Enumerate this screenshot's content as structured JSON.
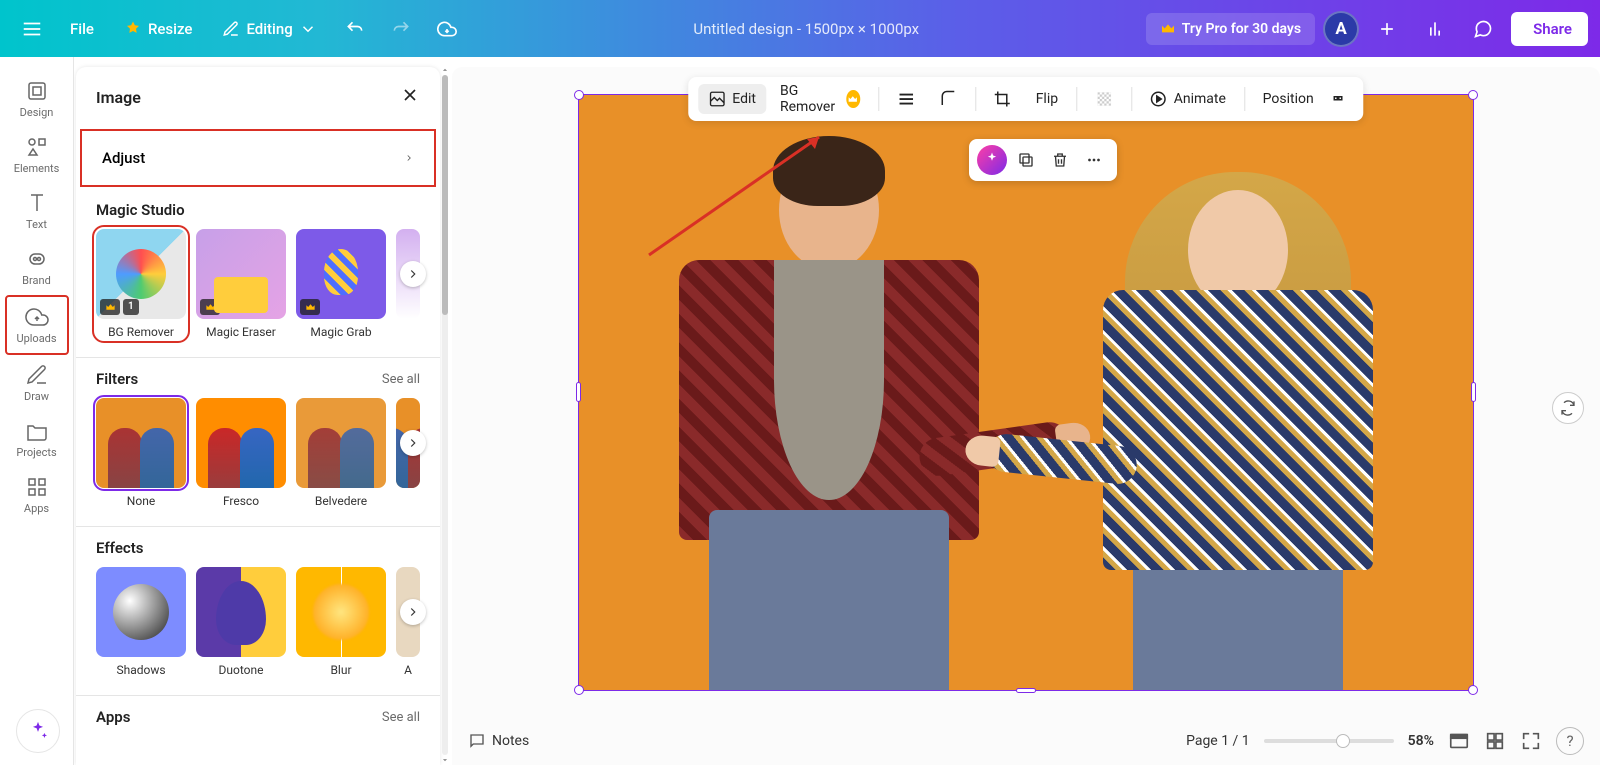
{
  "header": {
    "file": "File",
    "resize": "Resize",
    "editing": "Editing",
    "doc_title": "Untitled design - 1500px × 1000px",
    "try_pro": "Try Pro for 30 days",
    "avatar_initial": "A",
    "share": "Share"
  },
  "nav": {
    "design": "Design",
    "elements": "Elements",
    "text": "Text",
    "brand": "Brand",
    "uploads": "Uploads",
    "draw": "Draw",
    "projects": "Projects",
    "apps": "Apps"
  },
  "panel": {
    "title": "Image",
    "adjust": "Adjust",
    "magic_studio": "Magic Studio",
    "tools": {
      "bg_remover": "BG Remover",
      "magic_eraser": "Magic Eraser",
      "magic_grab": "Magic Grab",
      "bg_count": "1"
    },
    "filters": {
      "title": "Filters",
      "see_all": "See all",
      "none": "None",
      "fresco": "Fresco",
      "belvedere": "Belvedere"
    },
    "effects": {
      "title": "Effects",
      "shadows": "Shadows",
      "duotone": "Duotone",
      "blur": "Blur",
      "partial": "A"
    },
    "apps": {
      "title": "Apps",
      "see_all": "See all"
    }
  },
  "context_toolbar": {
    "edit": "Edit",
    "bg_remover": "BG Remover",
    "flip": "Flip",
    "animate": "Animate",
    "position": "Position"
  },
  "bottom": {
    "notes": "Notes",
    "page": "Page 1 / 1",
    "zoom": "58%"
  }
}
